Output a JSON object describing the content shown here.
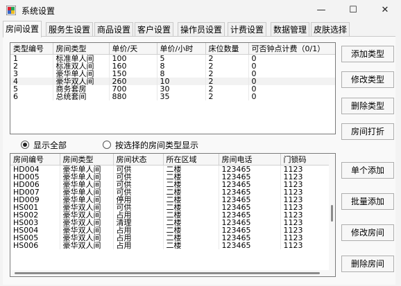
{
  "window": {
    "title": "系统设置",
    "minimize": "—",
    "maximize": "☐",
    "close": "✕"
  },
  "tabs": [
    "房间设置",
    "服务生设置",
    "商品设置",
    "客户设置",
    "操作员设置",
    "计费设置",
    "数据管理",
    "皮肤选择"
  ],
  "room_types": {
    "headers": [
      "类型编号",
      "房间类型",
      "单价/天",
      "单价/小时",
      "床位数量",
      "可否钟点计费（0/1）"
    ],
    "rows": [
      [
        "1",
        "标准单人间",
        "100",
        "5",
        "2",
        "0"
      ],
      [
        "2",
        "标准双人间",
        "160",
        "8",
        "2",
        "0"
      ],
      [
        "3",
        "豪华单人间",
        "150",
        "8",
        "2",
        "0"
      ],
      [
        "4",
        "豪华双人间",
        "260",
        "10",
        "2",
        "0"
      ],
      [
        "5",
        "商务套房",
        "700",
        "30",
        "2",
        "0"
      ],
      [
        "6",
        "总统套间",
        "880",
        "35",
        "2",
        "0"
      ]
    ]
  },
  "filter": {
    "show_all": "显示全部",
    "by_type": "按选择的房间类型显示"
  },
  "rooms": {
    "headers": [
      "房间编号",
      "房间类型",
      "房间状态",
      "所在区域",
      "房间电话",
      "门锁码"
    ],
    "rows": [
      [
        "HD004",
        "豪华单人间",
        "可供",
        "二楼",
        "123465",
        "1123"
      ],
      [
        "HD005",
        "豪华单人间",
        "可供",
        "二楼",
        "123465",
        "1123"
      ],
      [
        "HD006",
        "豪华单人间",
        "可供",
        "二楼",
        "123465",
        "1123"
      ],
      [
        "HD007",
        "豪华单人间",
        "可供",
        "二楼",
        "123465",
        "1123"
      ],
      [
        "HD009",
        "豪华单人间",
        "停用",
        "二楼",
        "123465",
        "1123"
      ],
      [
        "HS001",
        "豪华双人间",
        "可供",
        "二楼",
        "123465",
        "1123"
      ],
      [
        "HS002",
        "豪华双人间",
        "占用",
        "二楼",
        "123465",
        "1123"
      ],
      [
        "HS003",
        "豪华双人间",
        "清理",
        "二楼",
        "123465",
        "1123"
      ],
      [
        "HS004",
        "豪华双人间",
        "占用",
        "二楼",
        "123465",
        "1123"
      ],
      [
        "HS005",
        "豪华双人间",
        "占用",
        "二楼",
        "123465",
        "1123"
      ],
      [
        "HS006",
        "豪华双人间",
        "占用",
        "二楼",
        "123465",
        "1123"
      ]
    ]
  },
  "buttons": {
    "add_type": "添加类型",
    "edit_type": "修改类型",
    "delete_type": "删除类型",
    "room_discount": "房间打折",
    "add_single": "单个添加",
    "add_batch": "批量添加",
    "edit_room": "修改房间",
    "delete_room": "删除房间"
  }
}
